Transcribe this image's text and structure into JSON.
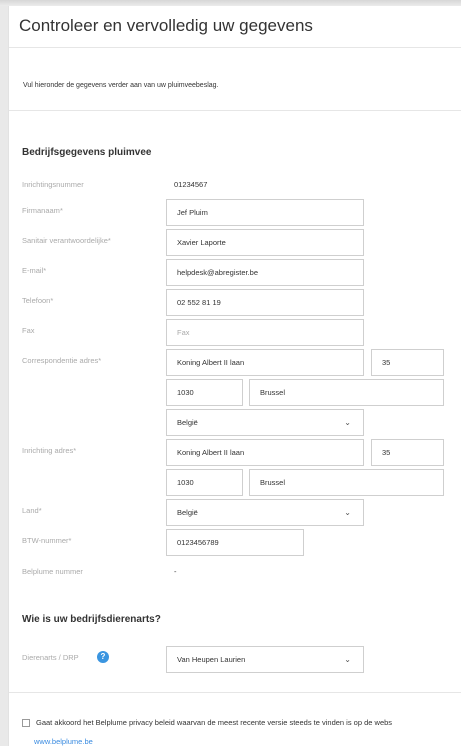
{
  "page": {
    "title": "Controleer en vervolledig uw gegevens",
    "intro": "Vul hieronder de gegevens verder aan van uw pluimveebeslag."
  },
  "company": {
    "section_title": "Bedrijfsgegevens pluimvee",
    "inrichtingsnummer_label": "Inrichtingsnummer",
    "inrichtingsnummer_value": "01234567",
    "firmanaam_label": "Firmanaam",
    "firmanaam_value": "Jef Pluim",
    "sanitair_label": "Sanitair verantwoordelijke",
    "sanitair_value": "Xavier Laporte",
    "email_label": "E-mail",
    "email_value": "helpdesk@abregister.be",
    "telefoon_label": "Telefoon",
    "telefoon_value": "02 552 81 19",
    "fax_label": "Fax",
    "fax_placeholder": "Fax",
    "corr_label": "Correspondentie adres",
    "corr_street": "Koning Albert II laan",
    "corr_number": "35",
    "corr_postcode": "1030",
    "corr_city": "Brussel",
    "corr_country": "België",
    "inr_label": "Inrichting adres",
    "inr_street": "Koning Albert II laan",
    "inr_number": "35",
    "inr_postcode": "1030",
    "inr_city": "Brussel",
    "land_label": "Land",
    "land_value": "België",
    "btw_label": "BTW-nummer",
    "btw_value": "0123456789",
    "belplume_label": "Belplume nummer",
    "belplume_value": "-",
    "required_marker": "*"
  },
  "vet": {
    "section_title": "Wie is uw bedrijfsdierenarts?",
    "label": "Dierenarts / DRP",
    "help_glyph": "?",
    "value": "Van Heupen Laurien"
  },
  "consent": {
    "text": "Gaat akkoord het Belplume privacy beleid waarvan de meest recente versie steeds te vinden is op de webs",
    "link": "www.belplume.be"
  },
  "icons": {
    "chevron": "⌄"
  }
}
